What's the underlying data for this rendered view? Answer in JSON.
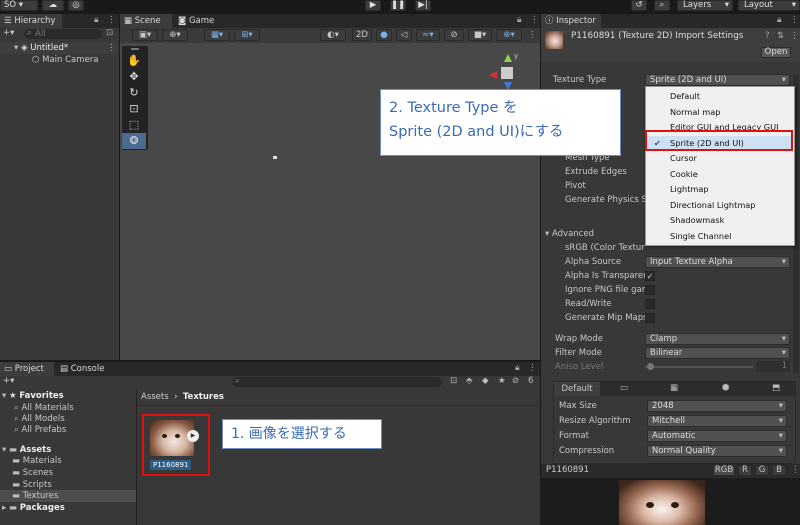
{
  "toolbar": {
    "account": "SO",
    "layers": "Layers",
    "layout": "Layout"
  },
  "hierarchy": {
    "tab": "Hierarchy",
    "search_placeholder": "All",
    "scene_name": "Untitled*",
    "items": [
      "Main Camera"
    ]
  },
  "scene": {
    "tabs": [
      "Scene",
      "Game"
    ],
    "mode_2d": "2D"
  },
  "project": {
    "tabs": [
      "Project",
      "Console"
    ],
    "badge_count": "6",
    "favorites": {
      "label": "Favorites",
      "items": [
        "All Materials",
        "All Models",
        "All Prefabs"
      ]
    },
    "assets": {
      "label": "Assets",
      "items": [
        "Materials",
        "Scenes",
        "Scripts",
        "Textures"
      ]
    },
    "packages": "Packages",
    "breadcrumb": [
      "Assets",
      "Textures"
    ],
    "asset_name": "P1160891"
  },
  "inspector": {
    "tab": "Inspector",
    "title": "P1160891 (Texture 2D) Import Settings",
    "open_button": "Open",
    "texture_type_label": "Texture Type",
    "texture_type_value": "Sprite (2D and UI)",
    "hidden_rows": [
      "Mesh Type",
      "Extrude Edges",
      "Pivot",
      "Generate Physics S"
    ],
    "advanced_label": "Advanced",
    "advanced_rows": [
      {
        "label": "sRGB (Color Textur",
        "value": ""
      },
      {
        "label": "Alpha Source",
        "value": "Input Texture Alpha"
      },
      {
        "label": "Alpha Is Transparen",
        "value": "✓"
      },
      {
        "label": "Ignore PNG file gam",
        "value": ""
      },
      {
        "label": "Read/Write",
        "value": ""
      },
      {
        "label": "Generate Mip Maps",
        "value": ""
      }
    ],
    "wrap_mode": {
      "label": "Wrap Mode",
      "value": "Clamp"
    },
    "filter_mode": {
      "label": "Filter Mode",
      "value": "Bilinear"
    },
    "aniso": {
      "label": "Aniso Level",
      "value": "1"
    },
    "platform_default": "Default",
    "platform_rows": [
      {
        "label": "Max Size",
        "value": "2048"
      },
      {
        "label": "Resize Algorithm",
        "value": "Mitchell"
      },
      {
        "label": "Format",
        "value": "Automatic"
      },
      {
        "label": "Compression",
        "value": "Normal Quality"
      }
    ],
    "preview_name": "P1160891",
    "channels": [
      "RGB",
      "R",
      "G",
      "B"
    ]
  },
  "dropdown_menu": {
    "items": [
      "Default",
      "Normal map",
      "Editor GUI and Legacy GUI",
      "Sprite (2D and UI)",
      "Cursor",
      "Cookie",
      "Lightmap",
      "Directional Lightmap",
      "Shadowmask",
      "Single Channel"
    ],
    "selected": "Sprite (2D and UI)"
  },
  "callouts": {
    "step1": "1. 画像を選択する",
    "step2_line1": "2. Texture Type を",
    "step2_line2": "Sprite (2D and UI)にする"
  },
  "colors": {
    "highlight_red": "#e01010",
    "callout_text": "#3a6bb5",
    "selection_blue": "#2c5d87",
    "menu_bg": "#f0f0f0"
  },
  "icons": [
    "cloud-icon",
    "collab-icon",
    "play-icon",
    "pause-icon",
    "step-icon",
    "history-icon",
    "search-icon",
    "lock-icon",
    "menu-icon",
    "hand-icon",
    "move-icon",
    "rotate-icon",
    "scale-icon",
    "rect-icon",
    "transform-icon",
    "gizmo-axis-icon",
    "star-icon",
    "folder-icon",
    "camera-icon",
    "check-icon"
  ]
}
